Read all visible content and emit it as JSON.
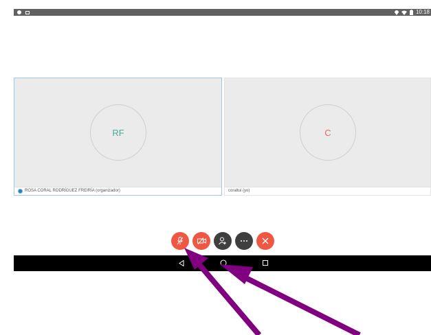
{
  "status_bar": {
    "time": "10:18",
    "icons": [
      "location-icon",
      "wifi-icon",
      "battery-icon",
      "notification-dot-icon",
      "image-icon"
    ]
  },
  "participants": [
    {
      "initials": "RF",
      "name": "ROSA CORAL RODRÍGUEZ FREIRÍA (organizador)",
      "speaking": true,
      "accent": "#4aa898"
    },
    {
      "initials": "C",
      "name": "coraltui (yo)",
      "speaking": false,
      "accent": "#e86a6a"
    }
  ],
  "controls": [
    {
      "name": "mute-mic",
      "icon": "microphone-off-icon",
      "color": "#ef5743"
    },
    {
      "name": "camera-off",
      "icon": "camera-off-icon",
      "color": "#ef5743"
    },
    {
      "name": "participants",
      "icon": "add-person-icon",
      "color": "#3f3f3f"
    },
    {
      "name": "more",
      "icon": "more-dots-icon",
      "color": "#3f3f3f"
    },
    {
      "name": "hang-up",
      "icon": "close-icon",
      "color": "#ef5743"
    }
  ],
  "annotation_color": "#800080"
}
